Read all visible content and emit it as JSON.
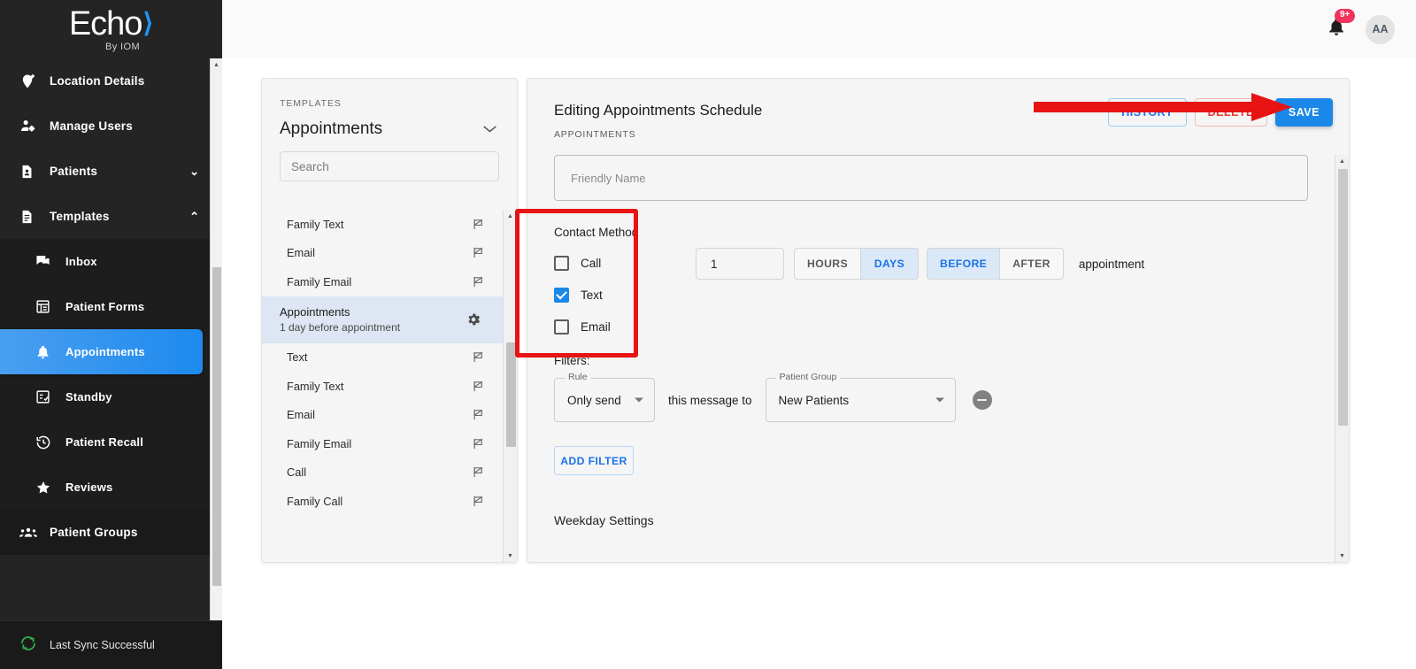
{
  "brand": {
    "name": "Echo",
    "tagline": "By IOM",
    "wave": "❯"
  },
  "sidebar": {
    "items": [
      {
        "label": "Location Details",
        "icon": "location-pin-edit-icon",
        "chevron": null,
        "level": "top",
        "active": false
      },
      {
        "label": "Manage Users",
        "icon": "user-settings-icon",
        "chevron": null,
        "level": "top",
        "active": false
      },
      {
        "label": "Patients",
        "icon": "patient-file-icon",
        "chevron": "⌄",
        "level": "top",
        "active": false
      },
      {
        "label": "Templates",
        "icon": "document-icon",
        "chevron": "⌃",
        "level": "top",
        "active": false
      },
      {
        "label": "Inbox",
        "icon": "chat-bubbles-icon",
        "chevron": null,
        "level": "sub",
        "active": false
      },
      {
        "label": "Patient Forms",
        "icon": "form-list-icon",
        "chevron": null,
        "level": "sub",
        "active": false
      },
      {
        "label": "Appointments",
        "icon": "bell-icon",
        "chevron": null,
        "level": "sub",
        "active": true
      },
      {
        "label": "Standby",
        "icon": "checklist-icon",
        "chevron": null,
        "level": "sub",
        "active": false
      },
      {
        "label": "Patient Recall",
        "icon": "history-clock-icon",
        "chevron": null,
        "level": "sub",
        "active": false
      },
      {
        "label": "Reviews",
        "icon": "star-icon",
        "chevron": null,
        "level": "sub",
        "active": false
      },
      {
        "label": "Patient Groups",
        "icon": "group-people-icon",
        "chevron": null,
        "level": "groups",
        "active": false
      }
    ],
    "sync_status": "Last Sync Successful",
    "sync_icon": "refresh-icon"
  },
  "topbar": {
    "notification_count": "9+",
    "notification_icon": "bell-icon",
    "avatar_initials": "AA"
  },
  "templates_panel": {
    "eyebrow": "TEMPLATES",
    "title": "Appointments",
    "chevron_icon": "chevron-down-icon",
    "search_placeholder": "Search",
    "search_value": "",
    "items_above": [
      {
        "label": "Family Text",
        "icon": "flag-off-icon"
      },
      {
        "label": "Email",
        "icon": "flag-off-icon"
      },
      {
        "label": "Family Email",
        "icon": "flag-off-icon"
      }
    ],
    "selected": {
      "title": "Appointments",
      "subtitle": "1 day before appointment",
      "icon": "gear-icon"
    },
    "items_below": [
      {
        "label": "Text",
        "icon": "flag-off-icon"
      },
      {
        "label": "Family Text",
        "icon": "flag-off-icon"
      },
      {
        "label": "Email",
        "icon": "flag-off-icon"
      },
      {
        "label": "Family Email",
        "icon": "flag-off-icon"
      },
      {
        "label": "Call",
        "icon": "flag-off-icon"
      },
      {
        "label": "Family Call",
        "icon": "flag-off-icon"
      }
    ]
  },
  "editor": {
    "title": "Editing Appointments Schedule",
    "subtitle": "APPOINTMENTS",
    "buttons": {
      "history": "HISTORY",
      "delete": "DELETE",
      "save": "SAVE"
    },
    "friendly_name": {
      "placeholder": "Friendly Name",
      "value": ""
    },
    "contact_method": {
      "label": "Contact Method",
      "options": [
        {
          "label": "Call",
          "checked": false
        },
        {
          "label": "Text",
          "checked": true
        },
        {
          "label": "Email",
          "checked": false
        }
      ]
    },
    "timing": {
      "amount": "1",
      "units": [
        {
          "label": "HOURS",
          "selected": false
        },
        {
          "label": "DAYS",
          "selected": true
        }
      ],
      "relations": [
        {
          "label": "BEFORE",
          "selected": true
        },
        {
          "label": "AFTER",
          "selected": false
        }
      ],
      "suffix": "appointment"
    },
    "filters": {
      "label": "Filters:",
      "rule_legend": "Rule",
      "rule_value": "Only send",
      "middle_text": "this message to",
      "group_legend": "Patient Group",
      "group_value": "New Patients",
      "remove_icon": "minus-circle-icon",
      "add_filter_label": "ADD FILTER"
    },
    "weekday": {
      "heading": "Weekday Settings",
      "description": ""
    }
  },
  "annotations": {
    "highlight_box_label": "contact-method-highlight",
    "arrow_label": "save-button-pointer",
    "color": "#e81313"
  }
}
